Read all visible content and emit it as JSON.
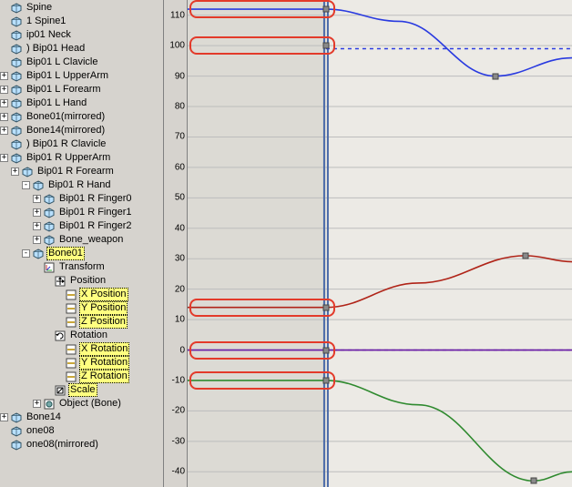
{
  "tree": {
    "nodes": [
      {
        "indent": 0,
        "plus": "",
        "icon": "cube",
        "label": "Spine",
        "hilite": false
      },
      {
        "indent": 0,
        "plus": "",
        "icon": "cube",
        "label": "1 Spine1",
        "hilite": false
      },
      {
        "indent": 0,
        "plus": "",
        "icon": "cube",
        "label": "ip01 Neck",
        "hilite": false
      },
      {
        "indent": 0,
        "plus": "",
        "icon": "cube",
        "label": ") Bip01 Head",
        "hilite": false
      },
      {
        "indent": 0,
        "plus": "",
        "icon": "cube",
        "label": "Bip01 L Clavicle",
        "hilite": false
      },
      {
        "indent": 0,
        "plus": "+",
        "icon": "cube",
        "label": "Bip01 L UpperArm",
        "hilite": false
      },
      {
        "indent": 0,
        "plus": "+",
        "icon": "cube",
        "label": "Bip01 L Forearm",
        "hilite": false
      },
      {
        "indent": 0,
        "plus": "+",
        "icon": "cube",
        "label": "Bip01 L Hand",
        "hilite": false
      },
      {
        "indent": 0,
        "plus": "+",
        "icon": "cube",
        "label": "Bone01(mirrored)",
        "hilite": false
      },
      {
        "indent": 0,
        "plus": "+",
        "icon": "cube",
        "label": "Bone14(mirrored)",
        "hilite": false
      },
      {
        "indent": 0,
        "plus": "",
        "icon": "cube",
        "label": ") Bip01 R Clavicle",
        "hilite": false
      },
      {
        "indent": 0,
        "plus": "+",
        "icon": "cube",
        "label": "Bip01 R UpperArm",
        "hilite": false
      },
      {
        "indent": 1,
        "plus": "+",
        "icon": "cube",
        "label": "Bip01 R Forearm",
        "hilite": false
      },
      {
        "indent": 2,
        "plus": "-",
        "icon": "cube",
        "label": "Bip01 R Hand",
        "hilite": false
      },
      {
        "indent": 3,
        "plus": "+",
        "icon": "cube",
        "label": "Bip01 R Finger0",
        "hilite": false
      },
      {
        "indent": 3,
        "plus": "+",
        "icon": "cube",
        "label": "Bip01 R Finger1",
        "hilite": false
      },
      {
        "indent": 3,
        "plus": "+",
        "icon": "cube",
        "label": "Bip01 R Finger2",
        "hilite": false
      },
      {
        "indent": 3,
        "plus": "+",
        "icon": "cube",
        "label": "Bone_weapon",
        "hilite": false
      },
      {
        "indent": 2,
        "plus": "-",
        "icon": "cube",
        "label": "Bone01",
        "hilite": true
      },
      {
        "indent": 3,
        "plus": "",
        "icon": "transform",
        "label": "Transform",
        "hilite": false
      },
      {
        "indent": 4,
        "plus": "",
        "icon": "pos",
        "label": "Position",
        "hilite": false
      },
      {
        "indent": 5,
        "plus": "",
        "icon": "track",
        "label": "X Position",
        "hilite": true
      },
      {
        "indent": 5,
        "plus": "",
        "icon": "track",
        "label": "Y Position",
        "hilite": true
      },
      {
        "indent": 5,
        "plus": "",
        "icon": "track",
        "label": "Z Position",
        "hilite": true
      },
      {
        "indent": 4,
        "plus": "",
        "icon": "rot",
        "label": "Rotation",
        "hilite": false
      },
      {
        "indent": 5,
        "plus": "",
        "icon": "track",
        "label": "X Rotation",
        "hilite": true
      },
      {
        "indent": 5,
        "plus": "",
        "icon": "track",
        "label": "Y Rotation",
        "hilite": true
      },
      {
        "indent": 5,
        "plus": "",
        "icon": "track",
        "label": "Z Rotation",
        "hilite": true
      },
      {
        "indent": 4,
        "plus": "",
        "icon": "scale",
        "label": "Scale",
        "hilite": true
      },
      {
        "indent": 3,
        "plus": "+",
        "icon": "obj",
        "label": "Object (Bone)",
        "hilite": false
      },
      {
        "indent": 0,
        "plus": "+",
        "icon": "cube",
        "label": "Bone14",
        "hilite": false
      },
      {
        "indent": 0,
        "plus": "",
        "icon": "cube",
        "label": "one08",
        "hilite": false
      },
      {
        "indent": 0,
        "plus": "",
        "icon": "cube",
        "label": "one08(mirrored)",
        "hilite": false
      }
    ]
  },
  "chart_data": {
    "type": "line",
    "ylabel": "",
    "xlabel": "",
    "ylim": [
      -45,
      115
    ],
    "y_ticks": [
      110,
      100,
      90,
      80,
      70,
      60,
      50,
      40,
      30,
      20,
      10,
      0,
      -10,
      -20,
      -30,
      -40
    ],
    "time_cursor": 0.36,
    "shaded_region": [
      0.0,
      0.36
    ],
    "series": [
      {
        "name": "blue-curve",
        "color": "#2a3be0",
        "keys": [
          {
            "x": 0.0,
            "y": 112
          },
          {
            "x": 0.36,
            "y": 112
          },
          {
            "x": 0.55,
            "y": 108
          },
          {
            "x": 0.8,
            "y": 90
          },
          {
            "x": 1.0,
            "y": 96
          }
        ],
        "flat_left": true,
        "dashed_right_at": 99
      },
      {
        "name": "red-curve",
        "color": "#b02418",
        "keys": [
          {
            "x": 0.0,
            "y": 14
          },
          {
            "x": 0.36,
            "y": 14
          },
          {
            "x": 0.6,
            "y": 22
          },
          {
            "x": 0.88,
            "y": 31
          },
          {
            "x": 1.0,
            "y": 29
          }
        ],
        "flat_left": true
      },
      {
        "name": "purple-curve",
        "color": "#6a1ea8",
        "keys": [
          {
            "x": 0.0,
            "y": 0
          },
          {
            "x": 0.36,
            "y": 0
          },
          {
            "x": 1.0,
            "y": 0
          }
        ],
        "flat_left": true,
        "dashed_right_at": 0
      },
      {
        "name": "green-curve",
        "color": "#2f8a2f",
        "keys": [
          {
            "x": 0.0,
            "y": -10
          },
          {
            "x": 0.36,
            "y": -10
          },
          {
            "x": 0.6,
            "y": -18
          },
          {
            "x": 0.9,
            "y": -43
          },
          {
            "x": 1.0,
            "y": -40
          }
        ],
        "flat_left": true
      }
    ],
    "highlight_boxes": [
      {
        "y": 112,
        "left": 0.0,
        "right": 0.38
      },
      {
        "y": 100,
        "left": 0.0,
        "right": 0.38
      },
      {
        "y": 14,
        "left": 0.0,
        "right": 0.38
      },
      {
        "y": 0,
        "left": 0.0,
        "right": 0.38
      },
      {
        "y": -10,
        "left": 0.0,
        "right": 0.38
      }
    ],
    "key_markers": [
      {
        "x": 0.36,
        "y": 112
      },
      {
        "x": 0.8,
        "y": 90
      },
      {
        "x": 0.36,
        "y": 100
      },
      {
        "x": 0.36,
        "y": 14
      },
      {
        "x": 0.88,
        "y": 31
      },
      {
        "x": 0.36,
        "y": 0
      },
      {
        "x": 0.36,
        "y": -10
      },
      {
        "x": 0.9,
        "y": -43
      }
    ]
  },
  "colors": {
    "grid": "#bdbdbd",
    "grid_zero": "#707070",
    "shade": "#dcdad4",
    "cursor": "#4a6aa8"
  }
}
